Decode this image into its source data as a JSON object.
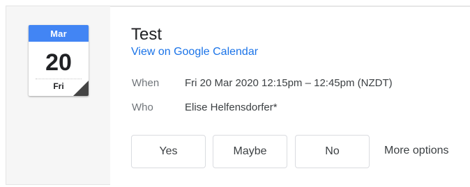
{
  "calendar_icon": {
    "month": "Mar",
    "day": "20",
    "weekday": "Fri"
  },
  "event": {
    "title": "Test",
    "link_label": "View on Google Calendar",
    "when_label": "When",
    "when_value": "Fri 20 Mar 2020 12:15pm – 12:45pm (NZDT)",
    "who_label": "Who",
    "who_value": "Elise Helfensdorfer*"
  },
  "rsvp": {
    "yes_label": "Yes",
    "maybe_label": "Maybe",
    "no_label": "No",
    "more_options_label": "More options"
  },
  "colors": {
    "month_band": "#4285f4",
    "link": "#1a73e8",
    "muted_text": "#70757a",
    "button_border": "#dadce0"
  }
}
